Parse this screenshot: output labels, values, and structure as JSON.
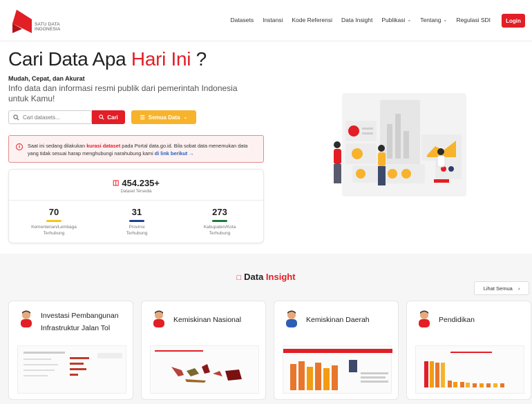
{
  "brand": {
    "logo_line1": "SATU DATA",
    "logo_line2": "INDONESIA",
    "accent": "#e21e26",
    "secondary": "#f7b32b"
  },
  "nav": {
    "items": [
      {
        "label": "Datasets",
        "has_dropdown": false
      },
      {
        "label": "Instansi",
        "has_dropdown": false
      },
      {
        "label": "Kode Referensi",
        "has_dropdown": false
      },
      {
        "label": "Data Insight",
        "has_dropdown": false
      },
      {
        "label": "Publikasi",
        "has_dropdown": true
      },
      {
        "label": "Tentang",
        "has_dropdown": true
      },
      {
        "label": "Regulasi SDI",
        "has_dropdown": false
      }
    ],
    "login_label": "Login"
  },
  "hero": {
    "title_main": "Cari Data Apa ",
    "title_highlight": "Hari Ini",
    "title_end": " ?",
    "subtitle": "Mudah, Cepat, dan Akurat",
    "description": "Info data dan informasi resmi publik dari pemerintah Indonesia untuk Kamu!"
  },
  "search": {
    "placeholder": "Cari datasets...",
    "button_label": "Cari",
    "filter_label": "Semua Data"
  },
  "alert": {
    "text_before": "Saat ini sedang dilakukan ",
    "highlight": "kurasi dataset",
    "text_middle": " pada Portal data.go.id. Bila sobat data menemukan data yang tidak sesuai harap menghubungi narahubung kami ",
    "link": "di link berikut →"
  },
  "stats": {
    "total_value": "454.235+",
    "total_label": "Dataset Tersedia",
    "items": [
      {
        "value": "70",
        "label_line1": "Kementerian/Lembaga",
        "label_line2": "Terhubung",
        "color": "#f7c51c"
      },
      {
        "value": "31",
        "label_line1": "Provinsi",
        "label_line2": "Terhubung",
        "color": "#1f3f8f"
      },
      {
        "value": "273",
        "label_line1": "Kabupaten/Kota",
        "label_line2": "Terhubung",
        "color": "#1b7a3a"
      }
    ]
  },
  "insight": {
    "title_prefix": "Data ",
    "title_highlight": "Insight",
    "see_all_label": "Lihat Semua",
    "cards": [
      {
        "title": "Investasi Pembangunan Infrastruktur Jalan Tol"
      },
      {
        "title": "Kemiskinan Nasional"
      },
      {
        "title": "Kemiskinan Daerah"
      },
      {
        "title": "Pendidikan"
      }
    ]
  }
}
